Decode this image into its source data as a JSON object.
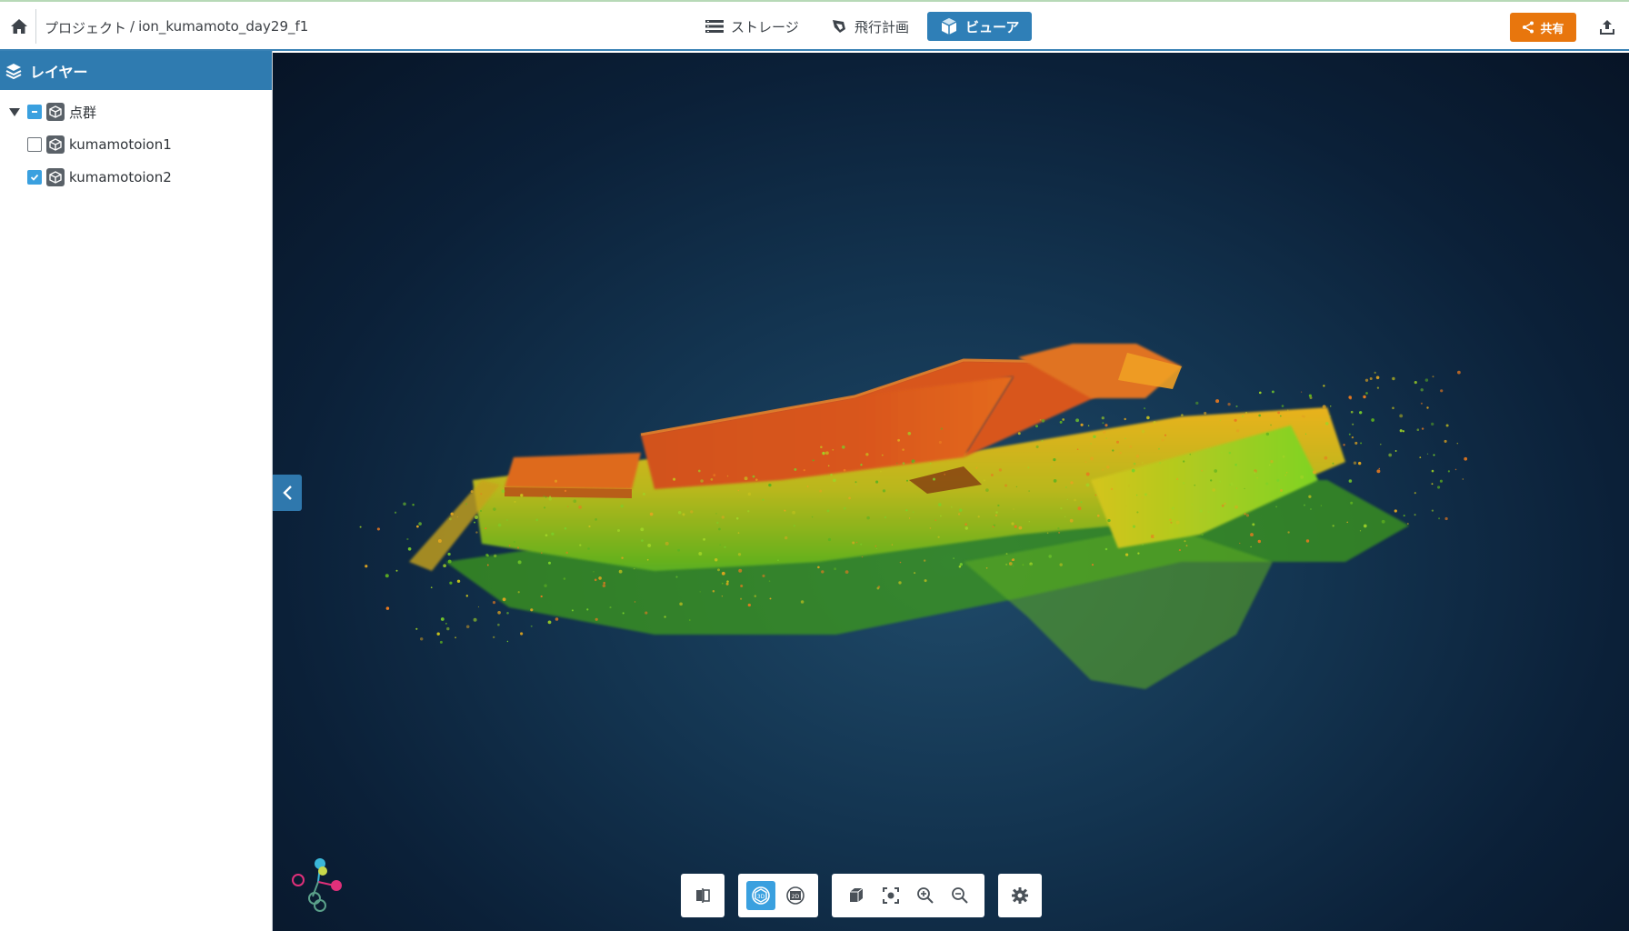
{
  "topbar": {
    "breadcrumb_project": "プロジェクト",
    "breadcrumb_separator": "/",
    "breadcrumb_dataset": "ion_kumamoto_day29_f1",
    "tabs": [
      {
        "label": "ストレージ",
        "icon": "list-icon",
        "active": false
      },
      {
        "label": "飛行計画",
        "icon": "drone-icon",
        "active": false
      },
      {
        "label": "ビューア",
        "icon": "cube-icon",
        "active": true
      }
    ],
    "share_label": "共有"
  },
  "sidebar": {
    "header": "レイヤー",
    "root": {
      "label": "点群",
      "state": "partial",
      "expanded": true
    },
    "layers": [
      {
        "label": "kumamotoion1",
        "checked": false
      },
      {
        "label": "kumamotoion2",
        "checked": true
      }
    ]
  },
  "viewer": {
    "mode": "3D",
    "toolbar": [
      "compare-icon",
      "view-3d-icon",
      "view-2d-icon",
      "box-view-icon",
      "focus-icon",
      "zoom-in-icon",
      "zoom-out-icon",
      "settings-icon"
    ],
    "gizmo_axes": [
      "X",
      "Y",
      "Z"
    ]
  },
  "colors": {
    "primary": "#2f7fb7",
    "share": "#e8760d",
    "checkbox": "#3aa0df"
  }
}
